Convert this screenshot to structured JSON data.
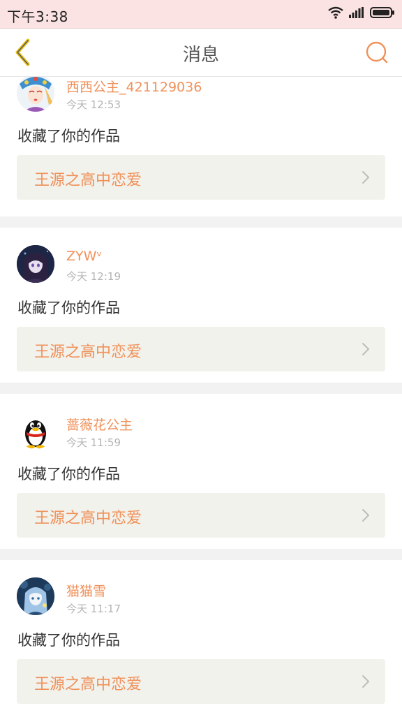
{
  "status_bar": {
    "time": "下午3:38",
    "icons": [
      "wifi-icon",
      "signal-icon",
      "battery-icon"
    ]
  },
  "header": {
    "title": "消息",
    "back_icon": "chevron-left-icon",
    "search_icon": "search-icon"
  },
  "colors": {
    "accent": "#f0915a",
    "back_arrow": "#e7c21c",
    "status_bar_bg": "#fce3e3",
    "link_bg": "#f2f2ec"
  },
  "messages": [
    {
      "username": "西西公主_421129036",
      "time": "今天 12:53",
      "action": "收藏了你的作品",
      "work_title": "王源之高中恋爱",
      "avatar": "opera-costume-avatar"
    },
    {
      "username": "ZYWᵛ",
      "time": "今天 12:19",
      "action": "收藏了你的作品",
      "work_title": "王源之高中恋爱",
      "avatar": "dark-anime-girl-avatar"
    },
    {
      "username": "蔷薇花公主",
      "time": "今天 11:59",
      "action": "收藏了你的作品",
      "work_title": "王源之高中恋爱",
      "avatar": "qq-penguin-avatar"
    },
    {
      "username": "猫猫雪",
      "time": "今天 11:17",
      "action": "收藏了你的作品",
      "work_title": "王源之高中恋爱",
      "avatar": "blue-anime-girl-avatar"
    }
  ]
}
